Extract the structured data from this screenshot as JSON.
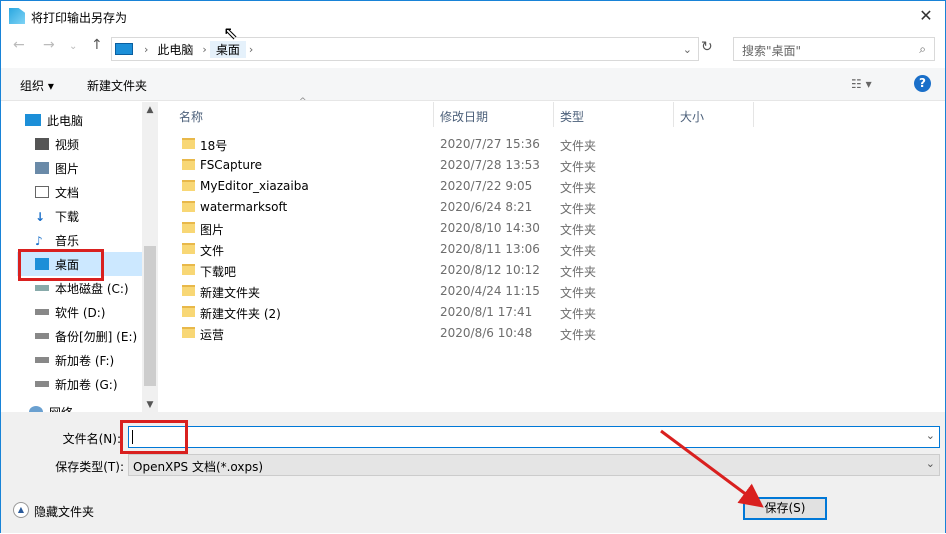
{
  "title": "将打印输出另存为",
  "breadcrumb": [
    "此电脑",
    "桌面"
  ],
  "search_placeholder": "搜索\"桌面\"",
  "toolbar": {
    "organize": "组织 ▾",
    "new_folder": "新建文件夹"
  },
  "sidebar": [
    "此电脑",
    "视频",
    "图片",
    "文档",
    "下载",
    "音乐",
    "桌面",
    "本地磁盘 (C:)",
    "软件 (D:)",
    "备份[勿删] (E:)",
    "新加卷 (F:)",
    "新加卷 (G:)",
    "网络"
  ],
  "columns": [
    "名称",
    "修改日期",
    "类型",
    "大小"
  ],
  "files": [
    {
      "name": "18号",
      "date": "2020/7/27 15:36",
      "type": "文件夹"
    },
    {
      "name": "FSCapture",
      "date": "2020/7/28 13:53",
      "type": "文件夹"
    },
    {
      "name": "MyEditor_xiazaiba",
      "date": "2020/7/22 9:05",
      "type": "文件夹"
    },
    {
      "name": "watermarksoft",
      "date": "2020/6/24 8:21",
      "type": "文件夹"
    },
    {
      "name": "图片",
      "date": "2020/8/10 14:30",
      "type": "文件夹"
    },
    {
      "name": "文件",
      "date": "2020/8/11 13:06",
      "type": "文件夹"
    },
    {
      "name": "下载吧",
      "date": "2020/8/12 10:12",
      "type": "文件夹"
    },
    {
      "name": "新建文件夹",
      "date": "2020/4/24 11:15",
      "type": "文件夹"
    },
    {
      "name": "新建文件夹 (2)",
      "date": "2020/8/1 17:41",
      "type": "文件夹"
    },
    {
      "name": "运营",
      "date": "2020/8/6 10:48",
      "type": "文件夹"
    }
  ],
  "filename_label": "文件名(N):",
  "filename_value": "",
  "filetype_label": "保存类型(T):",
  "filetype_value": "OpenXPS 文档(*.oxps)",
  "hide_folders": "隐藏文件夹",
  "save": "保存(S)",
  "help": "?"
}
